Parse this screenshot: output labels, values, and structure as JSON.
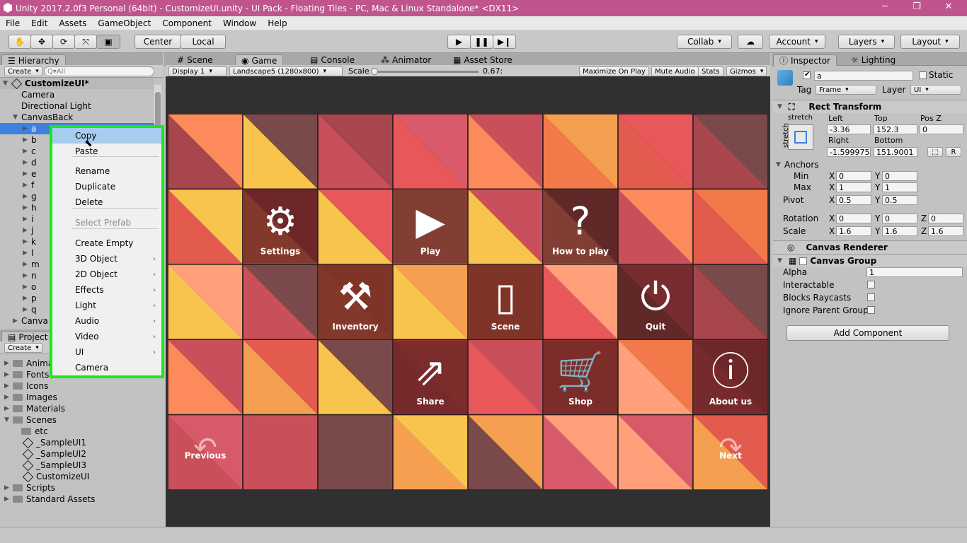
{
  "title_bar": {
    "title": "Unity 2017.2.0f3 Personal (64bit) - CustomizeUI.unity - UI Pack - Floating Tiles - PC, Mac & Linux Standalone* <DX11>",
    "minimize": "─",
    "restore": "❐",
    "close": "✕"
  },
  "menu": [
    "File",
    "Edit",
    "Assets",
    "GameObject",
    "Component",
    "Window",
    "Help"
  ],
  "toolbar": {
    "pivot_center": "Center",
    "pivot_local": "Local",
    "collab": "Collab",
    "account": "Account",
    "layers": "Layers",
    "layout": "Layout"
  },
  "hierarchy": {
    "tab": "Hierarchy",
    "create": "Create",
    "search_placeholder": "Q▾All",
    "scene_name": "CustomizeUI*",
    "items": [
      {
        "label": "Camera"
      },
      {
        "label": "Directional Light"
      },
      {
        "label": "CanvasBack"
      },
      {
        "label": "a"
      },
      {
        "label": "b"
      },
      {
        "label": "c"
      },
      {
        "label": "d"
      },
      {
        "label": "e"
      },
      {
        "label": "f"
      },
      {
        "label": "g"
      },
      {
        "label": "h"
      },
      {
        "label": "i"
      },
      {
        "label": "j"
      },
      {
        "label": "k"
      },
      {
        "label": "l"
      },
      {
        "label": "m"
      },
      {
        "label": "n"
      },
      {
        "label": "o"
      },
      {
        "label": "p"
      },
      {
        "label": "q"
      },
      {
        "label": "Canva"
      }
    ]
  },
  "context_menu": {
    "items": [
      {
        "label": "Copy"
      },
      {
        "label": "Paste"
      },
      {
        "label": "Rename"
      },
      {
        "label": "Duplicate"
      },
      {
        "label": "Delete"
      },
      {
        "label": "Select Prefab"
      },
      {
        "label": "Create Empty"
      },
      {
        "label": "3D Object"
      },
      {
        "label": "2D Object"
      },
      {
        "label": "Effects"
      },
      {
        "label": "Light"
      },
      {
        "label": "Audio"
      },
      {
        "label": "Video"
      },
      {
        "label": "UI"
      },
      {
        "label": "Camera"
      }
    ],
    "submenu_arrow": "›"
  },
  "project": {
    "tab": "Project",
    "create": "Create",
    "items": [
      {
        "label": "Anima"
      },
      {
        "label": "Fonts"
      },
      {
        "label": "Icons"
      },
      {
        "label": "Images"
      },
      {
        "label": "Materials"
      },
      {
        "label": "Scenes"
      },
      {
        "label": "etc"
      },
      {
        "label": "_SampleUI1"
      },
      {
        "label": "_SampleUI2"
      },
      {
        "label": "_SampleUI3"
      },
      {
        "label": "CustomizeUI"
      },
      {
        "label": "Scripts"
      },
      {
        "label": "Standard Assets"
      }
    ]
  },
  "center_tabs": [
    "Scene",
    "Game",
    "Console",
    "Animator",
    "Asset Store"
  ],
  "game_bar": {
    "display": "Display 1",
    "resolution": "Landscape5 (1280x800)",
    "scale_label": "Scale",
    "scale_value": "0.67:",
    "maximize": "Maximize On Play",
    "mute": "Mute Audio",
    "stats": "Stats",
    "gizmos": "Gizmos"
  },
  "game_buttons": [
    {
      "label": "Settings",
      "icon": "gear-icon"
    },
    {
      "label": "Play",
      "icon": "play-icon"
    },
    {
      "label": "How to play",
      "icon": "question-icon"
    },
    {
      "label": "Inventory",
      "icon": "hammer-icon"
    },
    {
      "label": "Scene",
      "icon": "map-icon"
    },
    {
      "label": "Quit",
      "icon": "power-icon"
    },
    {
      "label": "Share",
      "icon": "share-icon"
    },
    {
      "label": "Shop",
      "icon": "cart-icon"
    },
    {
      "label": "About us",
      "icon": "info-icon"
    },
    {
      "label": "Previous",
      "icon": "arrow-left-icon"
    },
    {
      "label": "Next",
      "icon": "arrow-right-icon"
    }
  ],
  "inspector": {
    "tab": "Inspector",
    "tab2": "Lighting",
    "object_name": "a",
    "static_label": "Static",
    "tag_label": "Tag",
    "tag_value": "Frame",
    "layer_label": "Layer",
    "layer_value": "UI",
    "rect_transform": {
      "title": "Rect Transform",
      "stretch": "stretch",
      "left_label": "Left",
      "top_label": "Top",
      "posz_label": "Pos Z",
      "left": "-3.36",
      "top": "152.3",
      "posz": "0",
      "right_label": "Right",
      "bottom_label": "Bottom",
      "right": "-1.599975",
      "bottom": "151.9001",
      "r_button": "R",
      "anchors": "Anchors",
      "min_label": "Min",
      "max_label": "Max",
      "min_x": "0",
      "min_y": "0",
      "max_x": "1",
      "max_y": "1",
      "pivot_label": "Pivot",
      "pivot_x": "0.5",
      "pivot_y": "0.5",
      "rotation_label": "Rotation",
      "rot_x": "0",
      "rot_y": "0",
      "rot_z": "0",
      "scale_label": "Scale",
      "scale_x": "1.6",
      "scale_y": "1.6",
      "scale_z": "1.6"
    },
    "canvas_renderer": "Canvas Renderer",
    "canvas_group": {
      "title": "Canvas Group",
      "alpha_label": "Alpha",
      "alpha": "1",
      "interactable": "Interactable",
      "blocks": "Blocks Raycasts",
      "ignore": "Ignore Parent Group"
    },
    "add_component": "Add Component"
  },
  "colors": {
    "title_bar": "#c0558d",
    "highlight": "#3d80df",
    "menu_border": "#17ea17",
    "tile_dark": "#5a1d1d",
    "game_bg": "#303030"
  }
}
